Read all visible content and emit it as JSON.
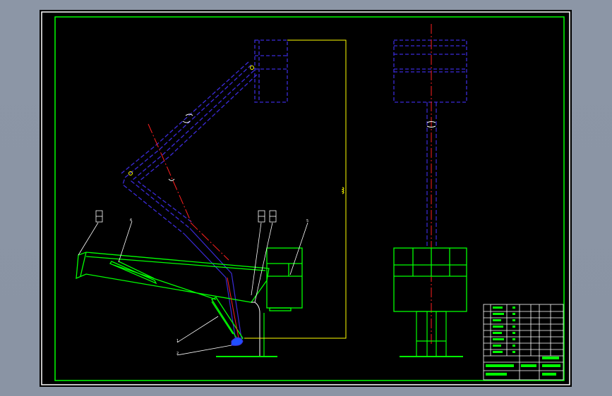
{
  "colors": {
    "background": "#000000",
    "frame": "#ffffff",
    "border": "#00ff00",
    "arm_outline": "#3b2bd8",
    "centerline": "#ff2020",
    "yellow": "#ffff00",
    "platform_fill": "#1f4fff"
  },
  "callouts": {
    "c1": "1",
    "c2": "2",
    "c3": "3",
    "c4": "4",
    "c5": "5",
    "c6": "6"
  },
  "title_block": {
    "rows": 12
  }
}
